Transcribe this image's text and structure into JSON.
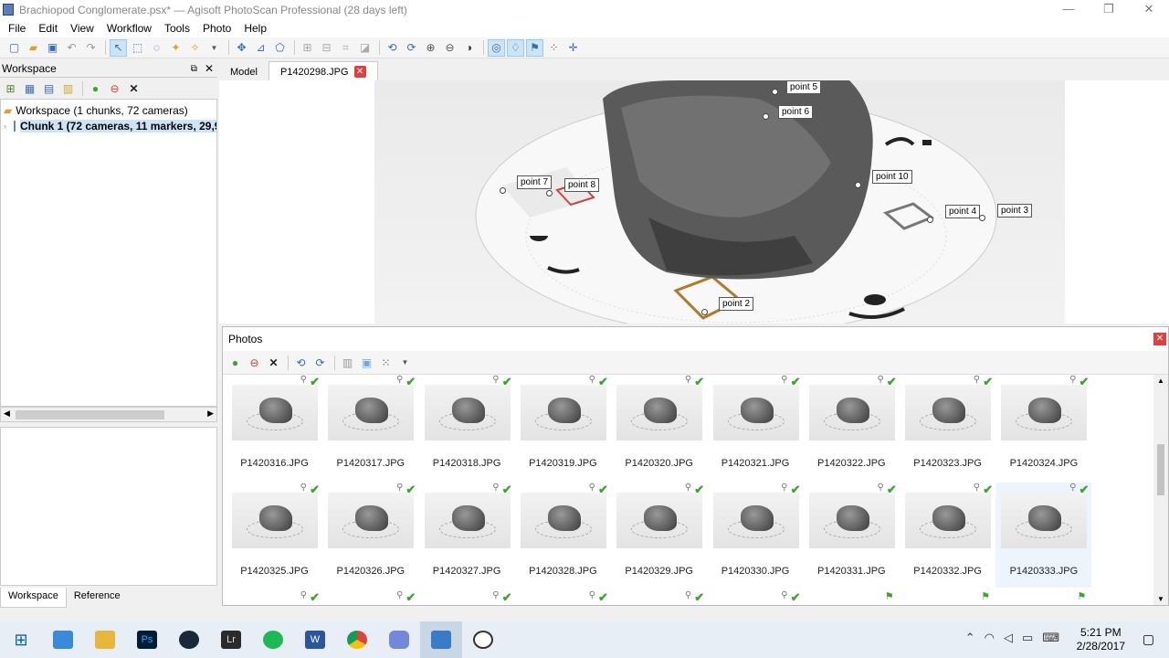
{
  "window": {
    "title": "Brachiopod Conglomerate.psx* — Agisoft PhotoScan Professional (28 days left)",
    "minimize": "—",
    "maximize": "❐",
    "close": "✕"
  },
  "menu": [
    "File",
    "Edit",
    "View",
    "Workflow",
    "Tools",
    "Photo",
    "Help"
  ],
  "workspace": {
    "panel_title": "Workspace",
    "root": "Workspace (1 chunks, 72 cameras)",
    "chunk": "Chunk 1 (72 cameras, 11 markers, 29,9"
  },
  "bottom_tabs": [
    "Workspace",
    "Reference"
  ],
  "doc_tabs": {
    "model": "Model",
    "photo": "P1420298.JPG"
  },
  "markers": [
    "point 5",
    "point 6",
    "point 7",
    "point 8",
    "point 10",
    "point 4",
    "point 3",
    "point 2"
  ],
  "photos": {
    "panel_title": "Photos",
    "rows": [
      [
        "P1420316.JPG",
        "P1420317.JPG",
        "P1420318.JPG",
        "P1420319.JPG",
        "P1420320.JPG",
        "P1420321.JPG",
        "P1420322.JPG",
        "P1420323.JPG",
        "P1420324.JPG"
      ],
      [
        "P1420325.JPG",
        "P1420326.JPG",
        "P1420327.JPG",
        "P1420328.JPG",
        "P1420329.JPG",
        "P1420330.JPG",
        "P1420331.JPG",
        "P1420332.JPG",
        "P1420333.JPG"
      ]
    ]
  },
  "clock": {
    "time": "5:21 PM",
    "date": "2/28/2017"
  }
}
